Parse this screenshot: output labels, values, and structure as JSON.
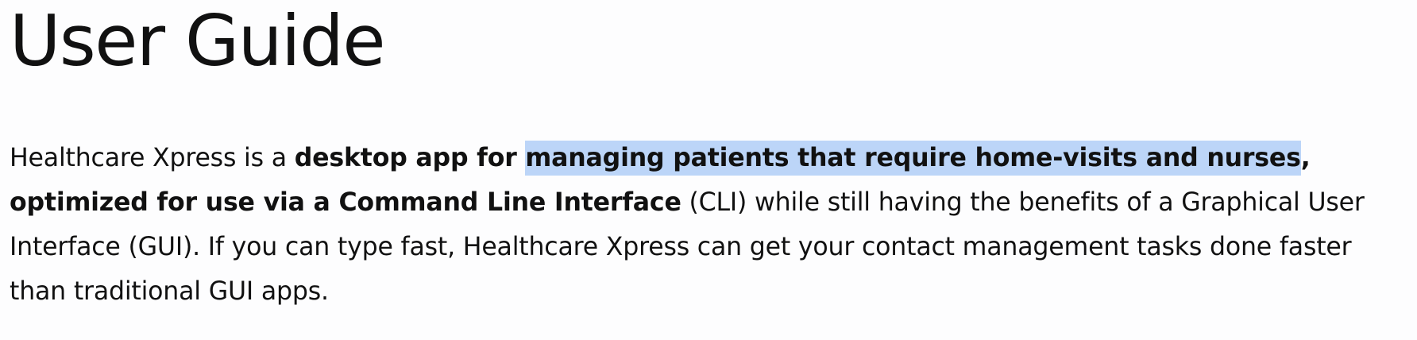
{
  "page": {
    "title": "User Guide"
  },
  "intro": {
    "line1": {
      "part1": "Healthcare Xpress is a ",
      "bold_part": "desktop app for ",
      "highlighted_bold": "managing patients that require home-visits and nurses",
      "bold_comma": ","
    },
    "line2": {
      "bold_part": "optimized for use via a Command Line Interface",
      "rest": " (CLI) while still having the benefits of a Graphical User"
    },
    "line3": "Interface (GUI). If you can type fast, Healthcare Xpress can get your contact management tasks done faster",
    "line4": "than traditional GUI apps."
  },
  "colors": {
    "text": "#111111",
    "highlight": "#bcd5f8",
    "background": "#fdfdfe"
  }
}
